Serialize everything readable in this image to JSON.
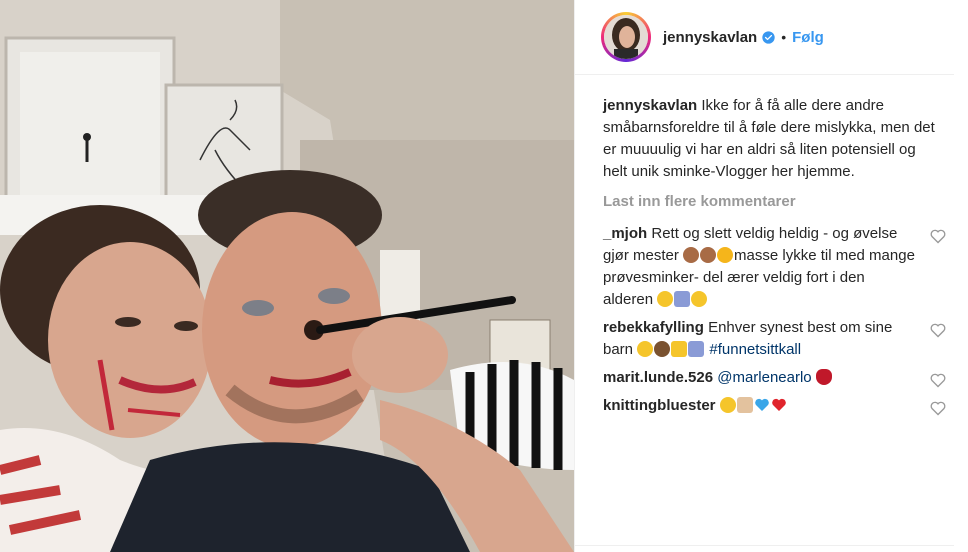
{
  "post": {
    "username": "jennyskavlan",
    "separator": "•",
    "follow_label": "Følg",
    "caption": "Ikke for å få alle dere andre småbarnsforeldre til å føle dere mislykka, men det er muuuulig vi har en aldri så liten potensiell og helt unik sminke-Vlogger her hjemme.",
    "load_more": "Last inn flere kommentarer"
  },
  "comments": [
    {
      "user": "_mjoh",
      "text_1": "Rett og slett veldig heldig - og øvelse gjør mester ",
      "text_2": "masse lykke til med mange prøvesminker- del ærer veldig fort i den alderen "
    },
    {
      "user": "rebekkafylling",
      "text_1": "Enhver synest best om sine barn ",
      "hashtag": "#funnetsittkall"
    },
    {
      "user": "marit.lunde.526",
      "mention": "@marlenearlo"
    },
    {
      "user": "knittingbluester",
      "text_1": ""
    }
  ],
  "colors": {
    "link": "#3897f0",
    "hashtag": "#003569",
    "muted": "#999999"
  }
}
